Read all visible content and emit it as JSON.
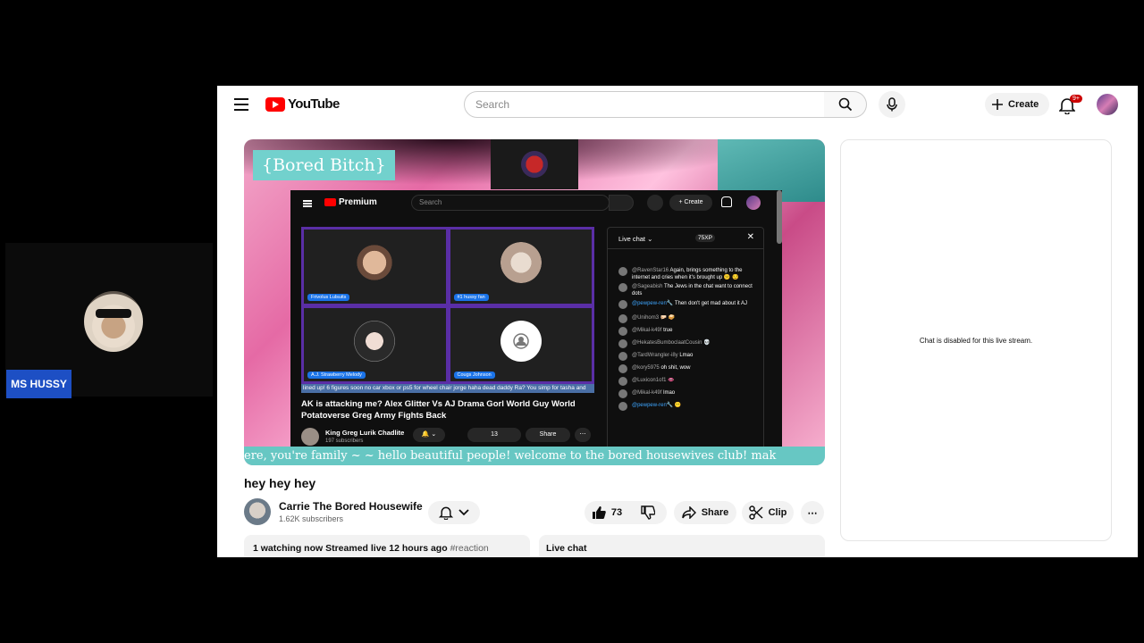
{
  "overlay": {
    "cam_label": "MS HUSSY"
  },
  "header": {
    "logo_text": "YouTube",
    "search_placeholder": "Search",
    "create_label": "Create",
    "notif_badge": "9+"
  },
  "stream": {
    "brand_text": "{Bored Bitch}",
    "ticker_text": "ere, you're family ~              ~ hello beautiful people! welcome to the bored housewives club! mak"
  },
  "inner": {
    "logo_text": "Premium",
    "search_placeholder": "Search",
    "create_label": "+ Create",
    "tiles": [
      {
        "label": "Frivolus Lulsuits"
      },
      {
        "label": "#1 hussy fan"
      },
      {
        "label": "A.J. Strawberry Melody"
      },
      {
        "label": "Cougs Johnson"
      }
    ],
    "ticker": "lined up! 6 figures soon no car xbox or ps5 for wheel chair jorge haha dead daddy Ra? You simp for tasha and",
    "video_title": "AK is attacking me? Alex Glitter Vs AJ Drama Gorl World Guy World Potatoverse Greg Army Fights Back",
    "channel_name": "King Greg Lurik Chadlite",
    "channel_subs": "197 subscribers",
    "likes": "13",
    "share": "Share",
    "chat": {
      "title": "Live chat ⌄",
      "xp": "75XP",
      "messages": [
        {
          "user": "@RavenStar16",
          "text": "Again, brings something to the internet and cries when it's brought up 😕 😒"
        },
        {
          "user": "@Sageabish",
          "text": "The Jews in the chat want to connect dots"
        },
        {
          "user": "@pewpew-ren🔧",
          "text": "Then don't get mad about it AJ",
          "blue": true
        },
        {
          "user": "@Unihom3",
          "text": "🤛🏻 🥪"
        },
        {
          "user": "@Mikal-k49f",
          "text": "true"
        },
        {
          "user": "@HekatesBumboclaatCousin",
          "text": "💀"
        },
        {
          "user": "@TardWrangler-i8y",
          "text": "Lmao"
        },
        {
          "user": "@kory5975",
          "text": "oh shit, wow"
        },
        {
          "user": "@Luxicon1of1",
          "text": "👄"
        },
        {
          "user": "@Mikal-k49f",
          "text": "lmao"
        },
        {
          "user": "@pewpew-ren🔧",
          "text": "😶",
          "blue": true
        }
      ]
    }
  },
  "video": {
    "title": "hey hey hey",
    "channel_name": "Carrie The Bored Housewife",
    "channel_subs": "1.62K subscribers",
    "likes": "73",
    "share_label": "Share",
    "clip_label": "Clip",
    "info_text": "1 watching now  Streamed live 12 hours ago",
    "info_tag": "#reaction",
    "live_chat_label": "Live chat"
  },
  "chat_panel": {
    "disabled_text": "Chat is disabled for this live stream."
  },
  "colors": {
    "brand_red": "#ff0000",
    "ticker_teal": "#67c7c3",
    "label_blue": "#1d4fc4"
  }
}
